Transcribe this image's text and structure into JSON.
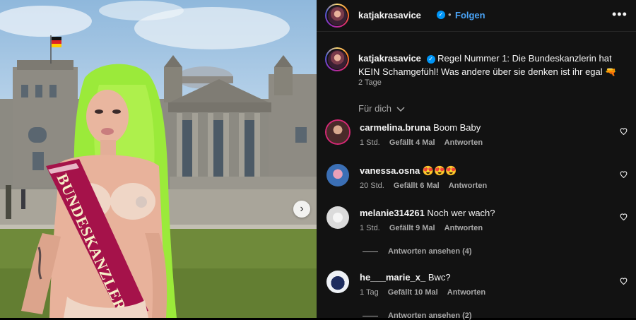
{
  "post": {
    "username": "katjakrasavice",
    "dot": "•",
    "follow_label": "Folgen",
    "more_icon": "more-horizontal-icon",
    "caption_text": "Regel Nummer 1: Die Bundeskanzlerin hat KEIN Schamgefühl! Was andere über sie denken ist ihr egal 🔫",
    "caption_time": "2 Tage",
    "for_you_label": "Für dich",
    "sash_text": "BUNDESKANZLERIN"
  },
  "comments": [
    {
      "username": "carmelina.bruna",
      "text": "Boom Baby",
      "time": "1 Std.",
      "likes": "Gefällt 4 Mal",
      "reply": "Antworten",
      "avatar_color": "#6b3a3a"
    },
    {
      "username": "vanessa.osna",
      "text": "😍😍😍",
      "time": "20 Std.",
      "likes": "Gefällt 6 Mal",
      "reply": "Antworten",
      "avatar_color": "#3b6fb5"
    },
    {
      "username": "melanie314261",
      "text": "Noch wer wach?",
      "time": "1 Std.",
      "likes": "Gefällt 9 Mal",
      "reply": "Antworten",
      "avatar_color": "#dbdbdb",
      "view_replies": "Antworten ansehen (4)"
    },
    {
      "username": "he___marie_x_",
      "text": "Bwc?",
      "time": "1 Tag",
      "likes": "Gefällt 10 Mal",
      "reply": "Antworten",
      "avatar_color": "#2d3f7a",
      "view_replies": "Antworten ansehen (2)"
    }
  ],
  "colors": {
    "panel_bg": "#121212",
    "follow_blue": "#4aa3f5",
    "verified_blue": "#0095f6",
    "meta_gray": "#a8a8a8"
  }
}
